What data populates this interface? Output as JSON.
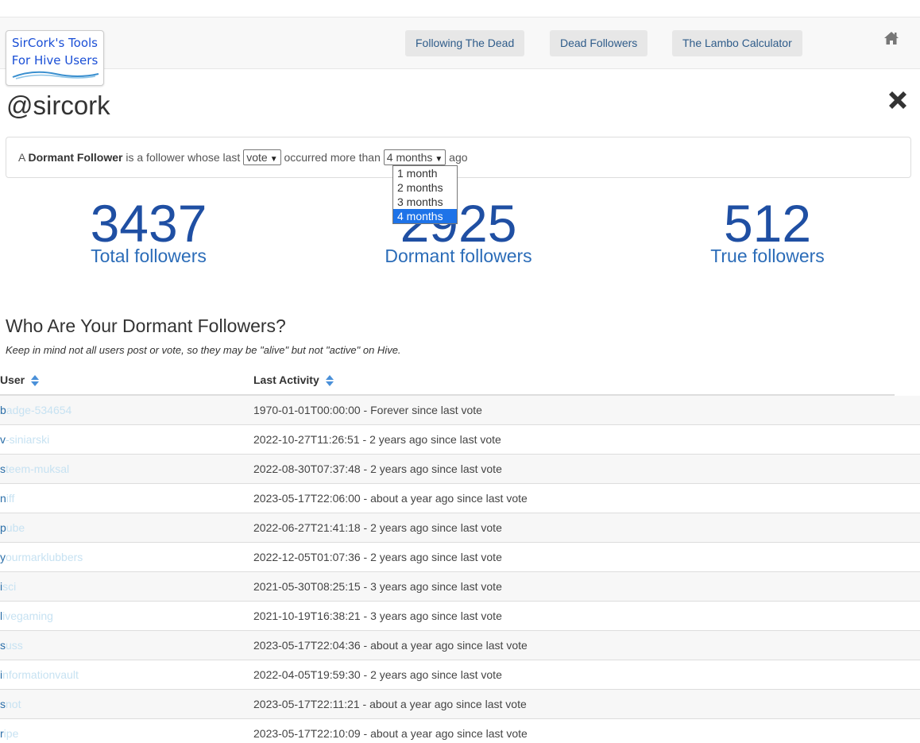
{
  "logo": {
    "line1": "SirCork's Tools",
    "line2": "For Hive Users"
  },
  "nav": {
    "items": [
      {
        "label": "Following The Dead"
      },
      {
        "label": "Dead Followers"
      },
      {
        "label": "The Lambo Calculator"
      }
    ],
    "home_icon": "home-icon"
  },
  "account": {
    "name": "@sircork"
  },
  "definition": {
    "prefix": "A",
    "term": "Dormant Follower",
    "middle": "is a follower whose last",
    "activity_select": "vote",
    "after_activity": "occurred more than",
    "period_select": "4 months",
    "suffix": "ago",
    "period_options": [
      "1 month",
      "2 months",
      "3 months",
      "4 months"
    ]
  },
  "stats": [
    {
      "value": "3437",
      "label": "Total followers"
    },
    {
      "value": "2925",
      "label": "Dormant followers"
    },
    {
      "value": "512",
      "label": "True followers"
    }
  ],
  "section": {
    "title": "Who Are Your Dormant Followers?",
    "note": "Keep in mind not all users post or vote, so they may be \"alive\" but not \"active\" on Hive."
  },
  "table": {
    "columns": [
      "User",
      "Last Activity"
    ],
    "rows": [
      {
        "user": "badge-534654",
        "activity": "1970-01-01T00:00:00 - Forever since last vote"
      },
      {
        "user": "v-siniarski",
        "activity": "2022-10-27T11:26:51 - 2 years ago since last vote"
      },
      {
        "user": "steem-muksal",
        "activity": "2022-08-30T07:37:48 - 2 years ago since last vote"
      },
      {
        "user": "niff",
        "activity": "2023-05-17T22:06:00 - about a year ago since last vote"
      },
      {
        "user": "pube",
        "activity": "2022-06-27T21:41:18 - 2 years ago since last vote"
      },
      {
        "user": "yourmarklubbers",
        "activity": "2022-12-05T01:07:36 - 2 years ago since last vote"
      },
      {
        "user": "isci",
        "activity": "2021-05-30T08:25:15 - 3 years ago since last vote"
      },
      {
        "user": "livegaming",
        "activity": "2021-10-19T16:38:21 - 3 years ago since last vote"
      },
      {
        "user": "suss",
        "activity": "2023-05-17T22:04:36 - about a year ago since last vote"
      },
      {
        "user": "informationvault",
        "activity": "2022-04-05T19:59:30 - 2 years ago since last vote"
      },
      {
        "user": "snot",
        "activity": "2023-05-17T22:11:21 - about a year ago since last vote"
      },
      {
        "user": "ripe",
        "activity": "2023-05-17T22:10:09 - about a year ago since last vote"
      }
    ]
  },
  "colors": {
    "accent": "#1f4fa3",
    "link": "#2a6ea8",
    "dropdown_highlight": "#1e73e8"
  }
}
